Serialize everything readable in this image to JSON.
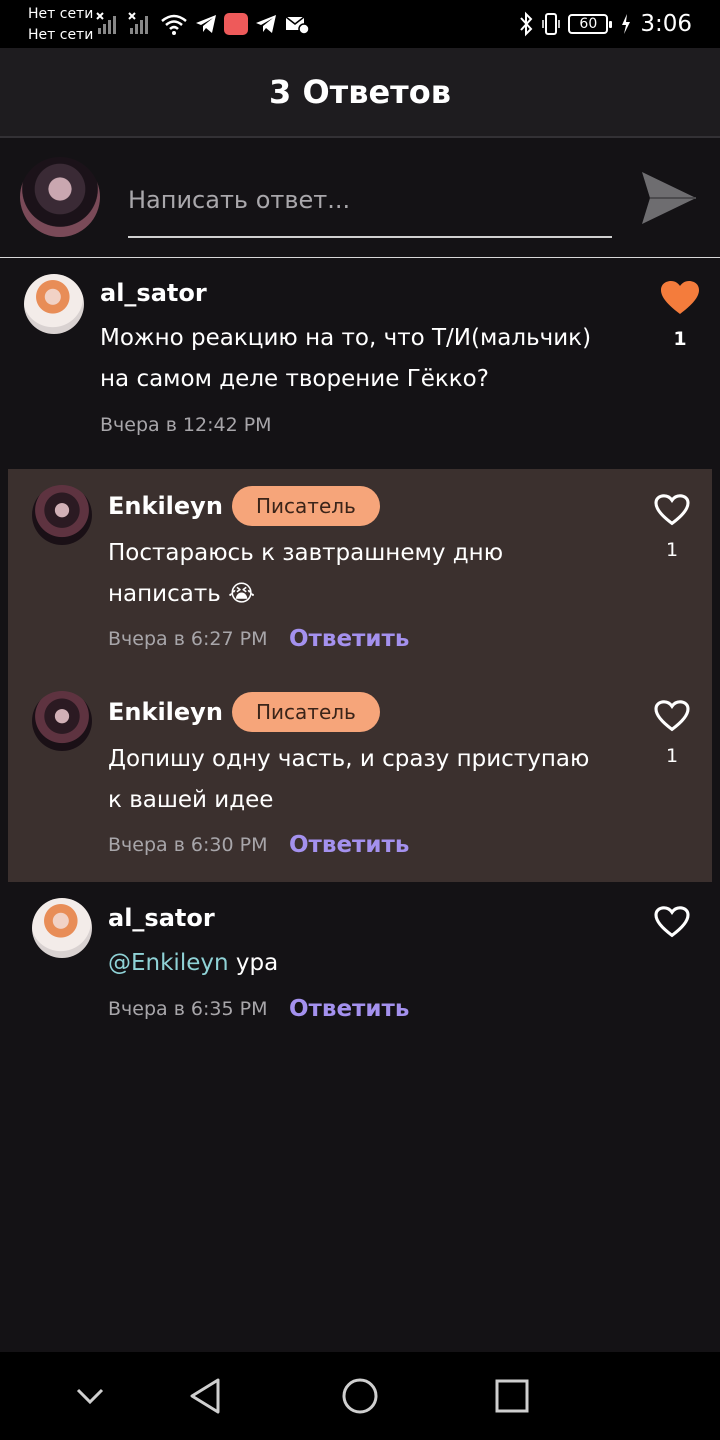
{
  "status_bar": {
    "carrier1": "Нет сети",
    "carrier2": "Нет сети",
    "battery": "60",
    "time": "3:06",
    "icons": [
      "signal-off-icon",
      "signal-off-icon",
      "wifi-icon",
      "telegram-icon",
      "app-icon",
      "telegram-icon",
      "mail-settings-icon",
      "bluetooth-icon",
      "vibrate-icon",
      "battery-icon",
      "charging-icon"
    ]
  },
  "header": {
    "title": "3 Ответов"
  },
  "composer": {
    "placeholder": "Написать ответ..."
  },
  "comments": [
    {
      "author": "al_sator",
      "text": "Можно реакцию на то, что Т/И(мальчик) на самом деле творение Гёкко?",
      "time": "Вчера в 12:42 PM",
      "likes": "1",
      "liked": true
    },
    {
      "author": "Enkileyn",
      "badge": "Писатель",
      "text": "Постараюсь к завтрашнему дню написать 😭",
      "time": "Вчера в 6:27 PM",
      "reply": "Ответить",
      "likes": "1"
    },
    {
      "author": "Enkileyn",
      "badge": "Писатель",
      "text": "Допишу одну часть, и сразу приступаю к вашей идее",
      "time": "Вчера в 6:30 PM",
      "reply": "Ответить",
      "likes": "1"
    },
    {
      "author": "al_sator",
      "mention": "@Enkileyn",
      "text": " ура",
      "time": "Вчера в 6:35 PM",
      "reply": "Ответить"
    }
  ],
  "colors": {
    "accent_like": "#f47c3c",
    "reply_link": "#a491ee",
    "badge_bg": "#f6a57a",
    "mention": "#8fd2d6",
    "thread_bg": "#3b302e"
  },
  "navbar": {
    "icons": [
      "chevron-down-icon",
      "back-icon",
      "home-icon",
      "recents-icon"
    ]
  }
}
